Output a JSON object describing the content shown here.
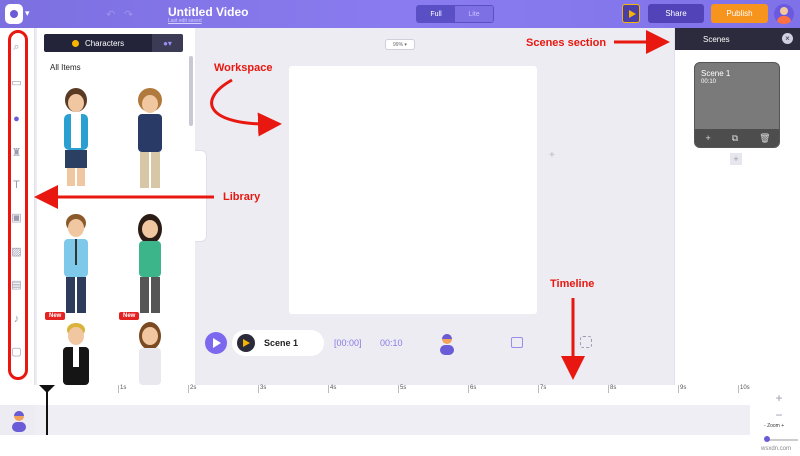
{
  "header": {
    "title": "Untitled Video",
    "subtitle": "Last edit saved",
    "toggle": {
      "full": "Full",
      "lite": "Lite"
    },
    "share": "Share",
    "publish": "Publish"
  },
  "workspace": {
    "zoom": "99%"
  },
  "library": {
    "tabs": {
      "characters": "Characters"
    },
    "section_label": "All Items",
    "badges": {
      "new": "New"
    }
  },
  "scenebar": {
    "scene_label": "Scene 1",
    "start": "[00:00]",
    "duration": "00:10"
  },
  "scenes_panel": {
    "header": "Scenes",
    "card": {
      "title": "Scene 1",
      "time": "00:10"
    }
  },
  "timeline": {
    "ticks": [
      "1s",
      "2s",
      "3s",
      "4s",
      "5s",
      "6s",
      "7s",
      "8s",
      "9s",
      "10s"
    ],
    "zoom_label": "Zoom"
  },
  "annotations": {
    "workspace": "Workspace",
    "scenes_section": "Scenes section",
    "library": "Library",
    "timeline": "Timeline"
  },
  "watermark": "wsxdn.com"
}
